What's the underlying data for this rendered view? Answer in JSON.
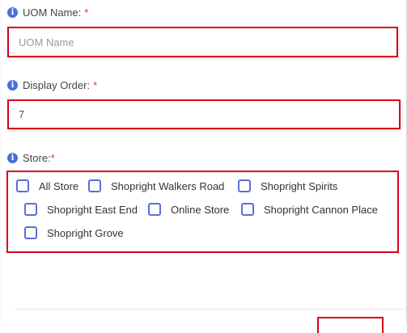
{
  "uom_name": {
    "label": "UOM Name:",
    "required_mark": "*",
    "placeholder": "UOM Name",
    "value": ""
  },
  "display_order": {
    "label": "Display Order:",
    "required_mark": "*",
    "value": "7"
  },
  "store": {
    "label": "Store:",
    "required_mark": "*",
    "options": [
      {
        "label": "All Store",
        "checked": false
      },
      {
        "label": "Shopright Walkers Road",
        "checked": false
      },
      {
        "label": "Shopright Spirits",
        "checked": false
      },
      {
        "label": "Shopright East End",
        "checked": false
      },
      {
        "label": "Online Store",
        "checked": false
      },
      {
        "label": "Shopright Cannon Place",
        "checked": false
      },
      {
        "label": "Shopright Grove",
        "checked": false
      }
    ]
  },
  "colors": {
    "highlight_border": "#d9001b",
    "required_mark": "#e0303a",
    "info_icon": "#4a6fd8",
    "checkbox_border": "#5b6fd9"
  }
}
